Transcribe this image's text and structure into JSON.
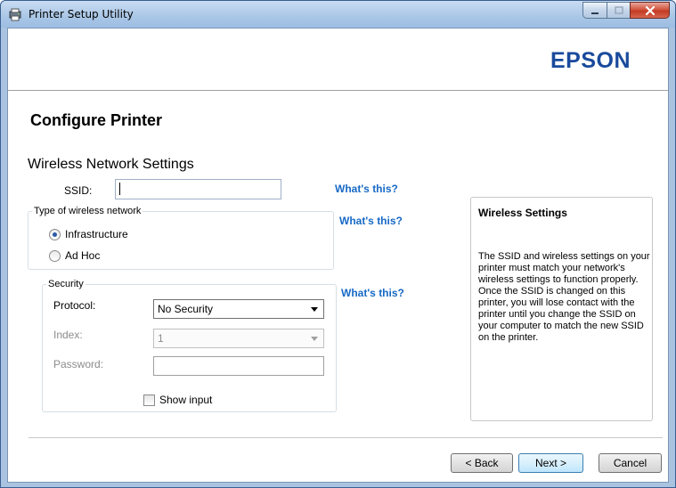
{
  "window": {
    "title": "Printer Setup Utility",
    "icon": "printer-utility-icon"
  },
  "brand": {
    "logo_text": "EPSON",
    "color": "#1a4a9c"
  },
  "page": {
    "title": "Configure Printer",
    "section_title": "Wireless Network Settings"
  },
  "ssid": {
    "label": "SSID:",
    "value": ""
  },
  "whats_this": {
    "ssid": "What's this?",
    "network_type": "What's this?",
    "security": "What's this?"
  },
  "network_type": {
    "legend": "Type of wireless network",
    "options": [
      {
        "label": "Infrastructure",
        "checked": true
      },
      {
        "label": "Ad Hoc",
        "checked": false
      }
    ]
  },
  "security": {
    "legend": "Security",
    "protocol_label": "Protocol:",
    "protocol_value": "No Security",
    "index_label": "Index:",
    "index_value": "1",
    "password_label": "Password:",
    "password_value": "",
    "show_input_label": "Show input"
  },
  "help": {
    "title": "Wireless Settings",
    "text": "The SSID and wireless settings on your printer must match your network's wireless settings to function properly. Once the SSID is changed on this printer, you will lose contact with the printer until you change the SSID on your computer to match the new SSID on the printer."
  },
  "footer": {
    "back_label": "< Back",
    "next_label": "Next >",
    "cancel_label": "Cancel"
  },
  "colors": {
    "link": "#1769c6",
    "title_bar": "#a9c6e6",
    "close_button": "#c23a23"
  }
}
